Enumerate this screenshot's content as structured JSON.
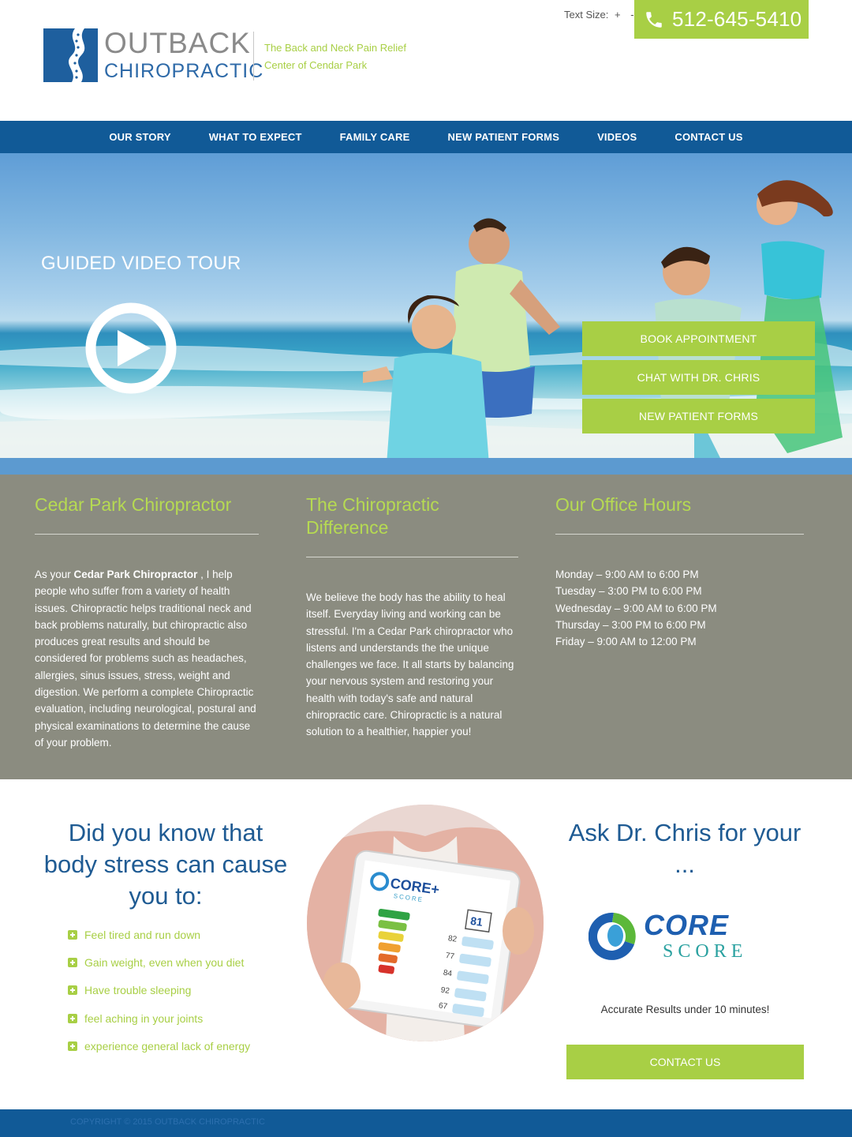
{
  "header": {
    "logo_line1": "OUTBACK",
    "logo_line2": "CHIROPRACTIC",
    "tagline_line1": "The Back and Neck Pain Relief",
    "tagline_line2": "Center of Cendar Park",
    "text_size_label": "Text Size:",
    "text_size_plus": "+",
    "text_size_minus": "-",
    "phone": "512-645-5410"
  },
  "nav": {
    "items": [
      "OUR STORY",
      "WHAT TO EXPECT",
      "FAMILY CARE",
      "NEW PATIENT FORMS",
      "VIDEOS",
      "CONTACT US"
    ]
  },
  "hero": {
    "video_title": "GUIDED VIDEO TOUR",
    "cta": [
      "BOOK APPOINTMENT",
      "CHAT WITH DR. CHRIS",
      "NEW PATIENT FORMS"
    ]
  },
  "info": {
    "col1": {
      "title": "Cedar Park Chiropractor",
      "intro": "As your ",
      "bold": "Cedar Park Chiropractor",
      "body": " , I help people who suffer from a variety of health issues. Chiropractic helps traditional neck and back problems naturally, but chiropractic also produces great results and should be considered for problems such as headaches, allergies, sinus issues, stress, weight and digestion. We perform a complete Chiropractic evaluation, including neurological, postural and physical examinations to determine the cause of your problem."
    },
    "col2": {
      "title": "The Chiropractic Difference",
      "body": "We believe the body has the ability to heal itself.  Everyday living and working can be stressful. I'm a Cedar Park chiropractor who listens and understands the the unique challenges we face.  It all starts by balancing your nervous system and restoring your health with today's safe and natural chiropractic care.  Chiropractic is a natural solution to a healthier, happier you!"
    },
    "col3": {
      "title": "Our Office Hours",
      "hours": [
        "Monday – 9:00 AM to 6:00 PM",
        "Tuesday – 3:00 PM to 6:00 PM",
        "Wednesday – 9:00 AM to 6:00 PM",
        "Thursday – 3:00 PM to 6:00 PM",
        "Friday – 9:00 AM to 12:00 PM"
      ]
    }
  },
  "lower": {
    "did_you_know": "Did you know that body stress can cause you to:",
    "symptoms": [
      "Feel tired and run down",
      "Gain weight, even when you diet",
      "Have trouble sleeping",
      "feel aching in your joints",
      "experience general lack of energy"
    ],
    "ask_title": "Ask Dr. Chris for your ...",
    "core_word": "CORE",
    "score_word": "SCORE",
    "accurate": "Accurate Results under 10 minutes!",
    "contact_button": "CONTACT US",
    "tablet": {
      "brand": "CORE+",
      "brand_sub": "SCORE",
      "overall_score": "81",
      "scores": [
        "82",
        "77",
        "84",
        "92",
        "67"
      ]
    }
  },
  "footer": {
    "copyright": "COPYRIGHT © 2015 OUTBACK CHIROPRACTIC"
  },
  "colors": {
    "brand_blue": "#115a97",
    "accent_green": "#a8cf45",
    "info_grey": "#8b8c80"
  }
}
